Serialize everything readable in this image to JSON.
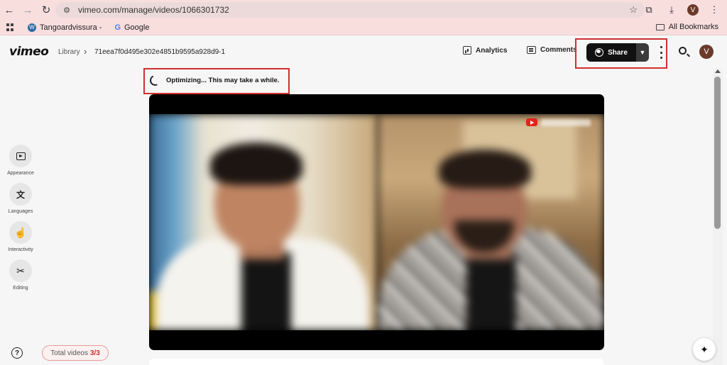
{
  "browser": {
    "url": "vimeo.com/manage/videos/1066301732",
    "profile_initial": "V",
    "bookmarks": [
      {
        "label": "Tangoardvissura -"
      },
      {
        "label": "Google"
      }
    ],
    "all_bookmarks_label": "All Bookmarks"
  },
  "header": {
    "logo": "vimeo",
    "breadcrumb_library": "Library",
    "breadcrumb_video_id": "71eea7f0d495e302e4851b9595a928d9-1",
    "analytics_label": "Analytics",
    "comments_label": "Comments",
    "share_label": "Share",
    "user_initial": "V"
  },
  "status": {
    "optimizing_text": "Optimizing... This may take a while."
  },
  "tools": [
    {
      "label": "Appearance",
      "icon": "play-square-icon"
    },
    {
      "label": "Languages",
      "icon": "translate-icon"
    },
    {
      "label": "Interactivity",
      "icon": "tap-icon"
    },
    {
      "label": "Editing",
      "icon": "scissors-icon"
    }
  ],
  "footer": {
    "total_videos_label": "Total videos",
    "total_videos_count": "3/3"
  },
  "colors": {
    "highlight": "#d12f2f",
    "share_bg": "#111111",
    "chrome_bg": "#f9dede"
  }
}
